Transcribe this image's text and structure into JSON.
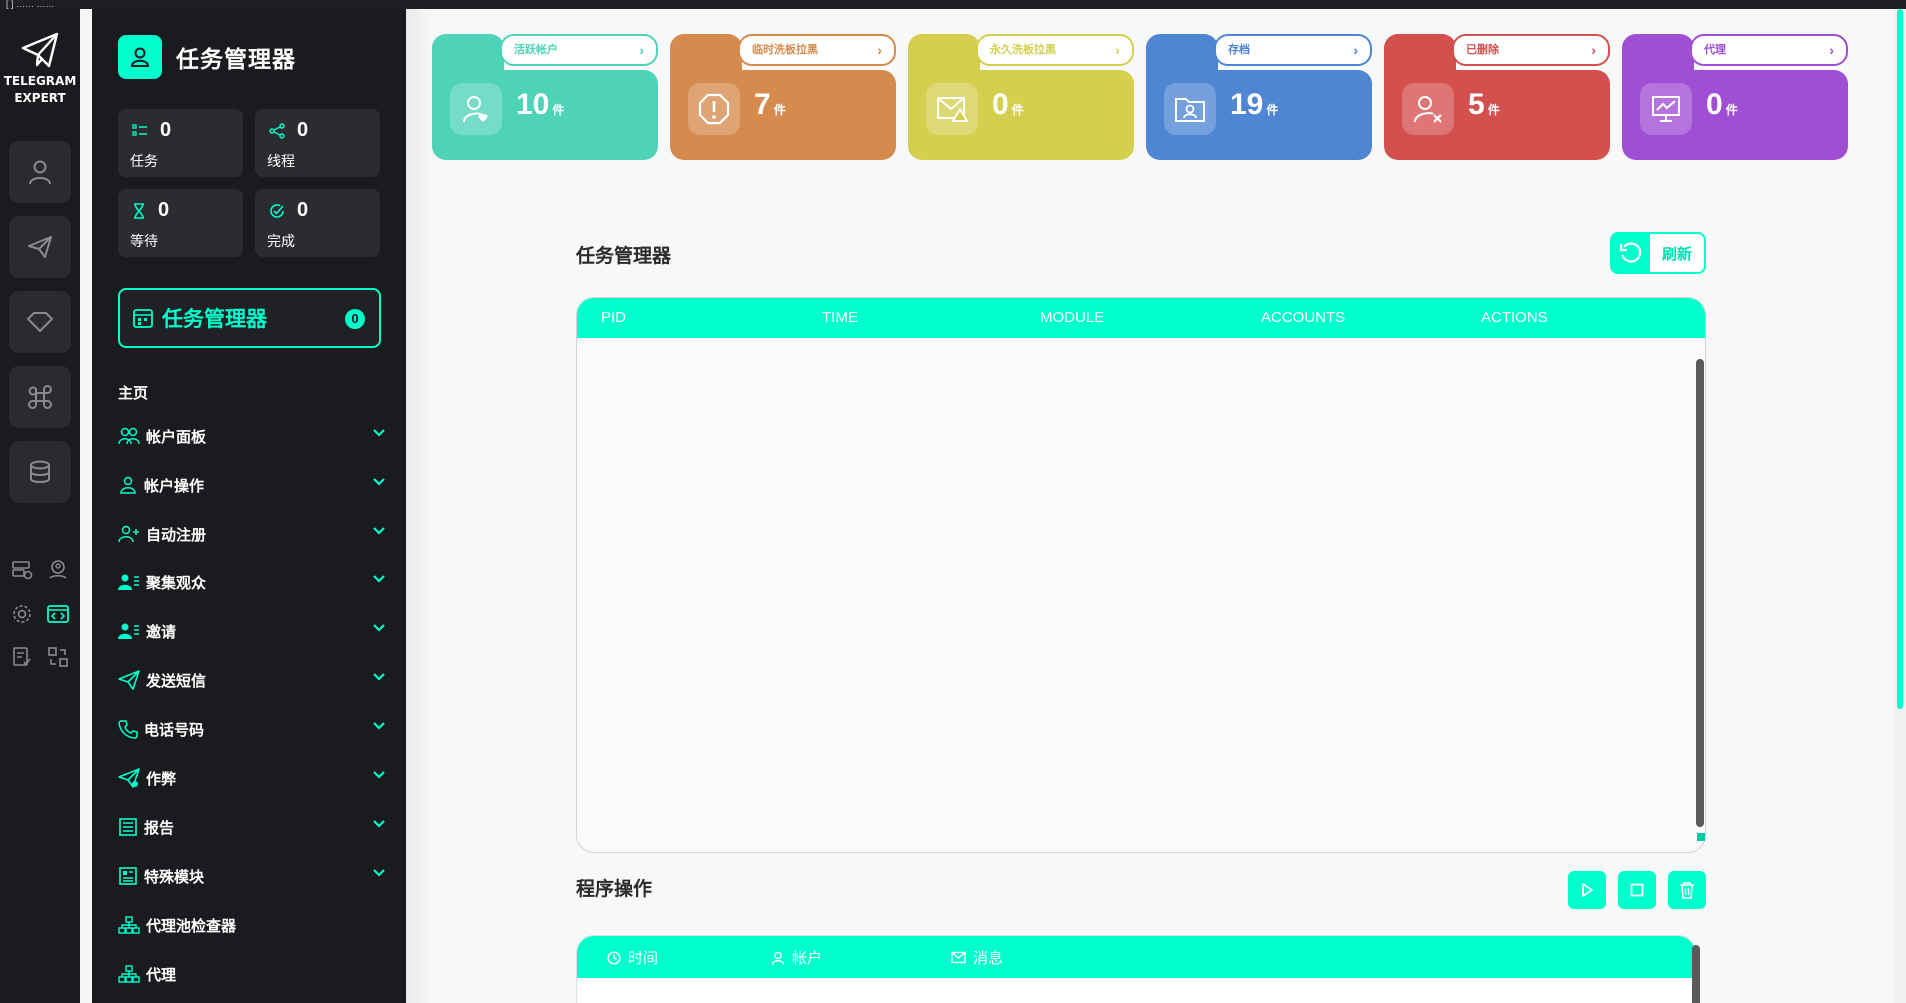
{
  "top_strip": "[ ] …… ……",
  "rail": {
    "brand_line1": "TELEGRAM",
    "brand_line2": "EXPERT",
    "buttons": [
      "user-icon",
      "send-icon",
      "diamond-icon",
      "command-icon",
      "database-icon"
    ],
    "small_icons": [
      "server-check-icon",
      "user-location-icon",
      "gear-icon",
      "code-window-icon",
      "doc-check-icon",
      "swap-icon"
    ]
  },
  "sidebar": {
    "title": "任务管理器",
    "stats": [
      {
        "value": "0",
        "label": "任务"
      },
      {
        "value": "0",
        "label": "线程"
      },
      {
        "value": "0",
        "label": "等待"
      },
      {
        "value": "0",
        "label": "完成"
      }
    ],
    "task_manager": {
      "label": "任务管理器",
      "count": "0"
    },
    "home_label": "主页",
    "nav": [
      {
        "label": "帐户面板",
        "icon": "users-icon"
      },
      {
        "label": "帐户操作",
        "icon": "user-icon"
      },
      {
        "label": "自动注册",
        "icon": "user-plus-icon"
      },
      {
        "label": "聚集观众",
        "icon": "user-list-icon"
      },
      {
        "label": "邀请",
        "icon": "user-list-icon"
      },
      {
        "label": "发送短信",
        "icon": "send-icon"
      },
      {
        "label": "电话号码",
        "icon": "phone-icon"
      },
      {
        "label": "作弊",
        "icon": "send-gear-icon"
      },
      {
        "label": "报告",
        "icon": "report-icon"
      },
      {
        "label": "特殊模块",
        "icon": "module-icon"
      },
      {
        "label": "代理池检查器",
        "icon": "network-icon"
      },
      {
        "label": "代理",
        "icon": "network-icon"
      }
    ]
  },
  "cards": [
    {
      "label": "活跃帐户",
      "value": "10",
      "unit": "件",
      "color": "#4ed3b9",
      "icon": "user-heart-icon"
    },
    {
      "label": "临时洗板拉黑",
      "value": "7",
      "unit": "件",
      "color": "#d58b4e",
      "icon": "alert-octagon-icon"
    },
    {
      "label": "永久洗板拉黑",
      "value": "0",
      "unit": "件",
      "color": "#d4cf4e",
      "icon": "mail-warning-icon"
    },
    {
      "label": "存档",
      "value": "19",
      "unit": "件",
      "color": "#4e86d4",
      "icon": "folder-user-icon"
    },
    {
      "label": "已删除",
      "value": "5",
      "unit": "件",
      "color": "#d4504e",
      "icon": "user-x-icon"
    },
    {
      "label": "代理",
      "value": "0",
      "unit": "件",
      "color": "#a04ed4",
      "icon": "monitor-icon"
    }
  ],
  "task_section": {
    "title": "任务管理器",
    "refresh_label": "刷新",
    "columns": [
      "PID",
      "TIME",
      "MODULE",
      "ACCOUNTS",
      "ACTIONS"
    ]
  },
  "ops_section": {
    "title": "程序操作",
    "buttons": [
      "play-icon",
      "stop-icon",
      "trash-icon"
    ],
    "columns": [
      {
        "label": "时间",
        "icon": "clock-icon"
      },
      {
        "label": "帐户",
        "icon": "user-icon"
      },
      {
        "label": "消息",
        "icon": "mail-icon"
      }
    ]
  },
  "colors": {
    "accent": "#00ffcc",
    "dark": "#1a1b1e"
  }
}
